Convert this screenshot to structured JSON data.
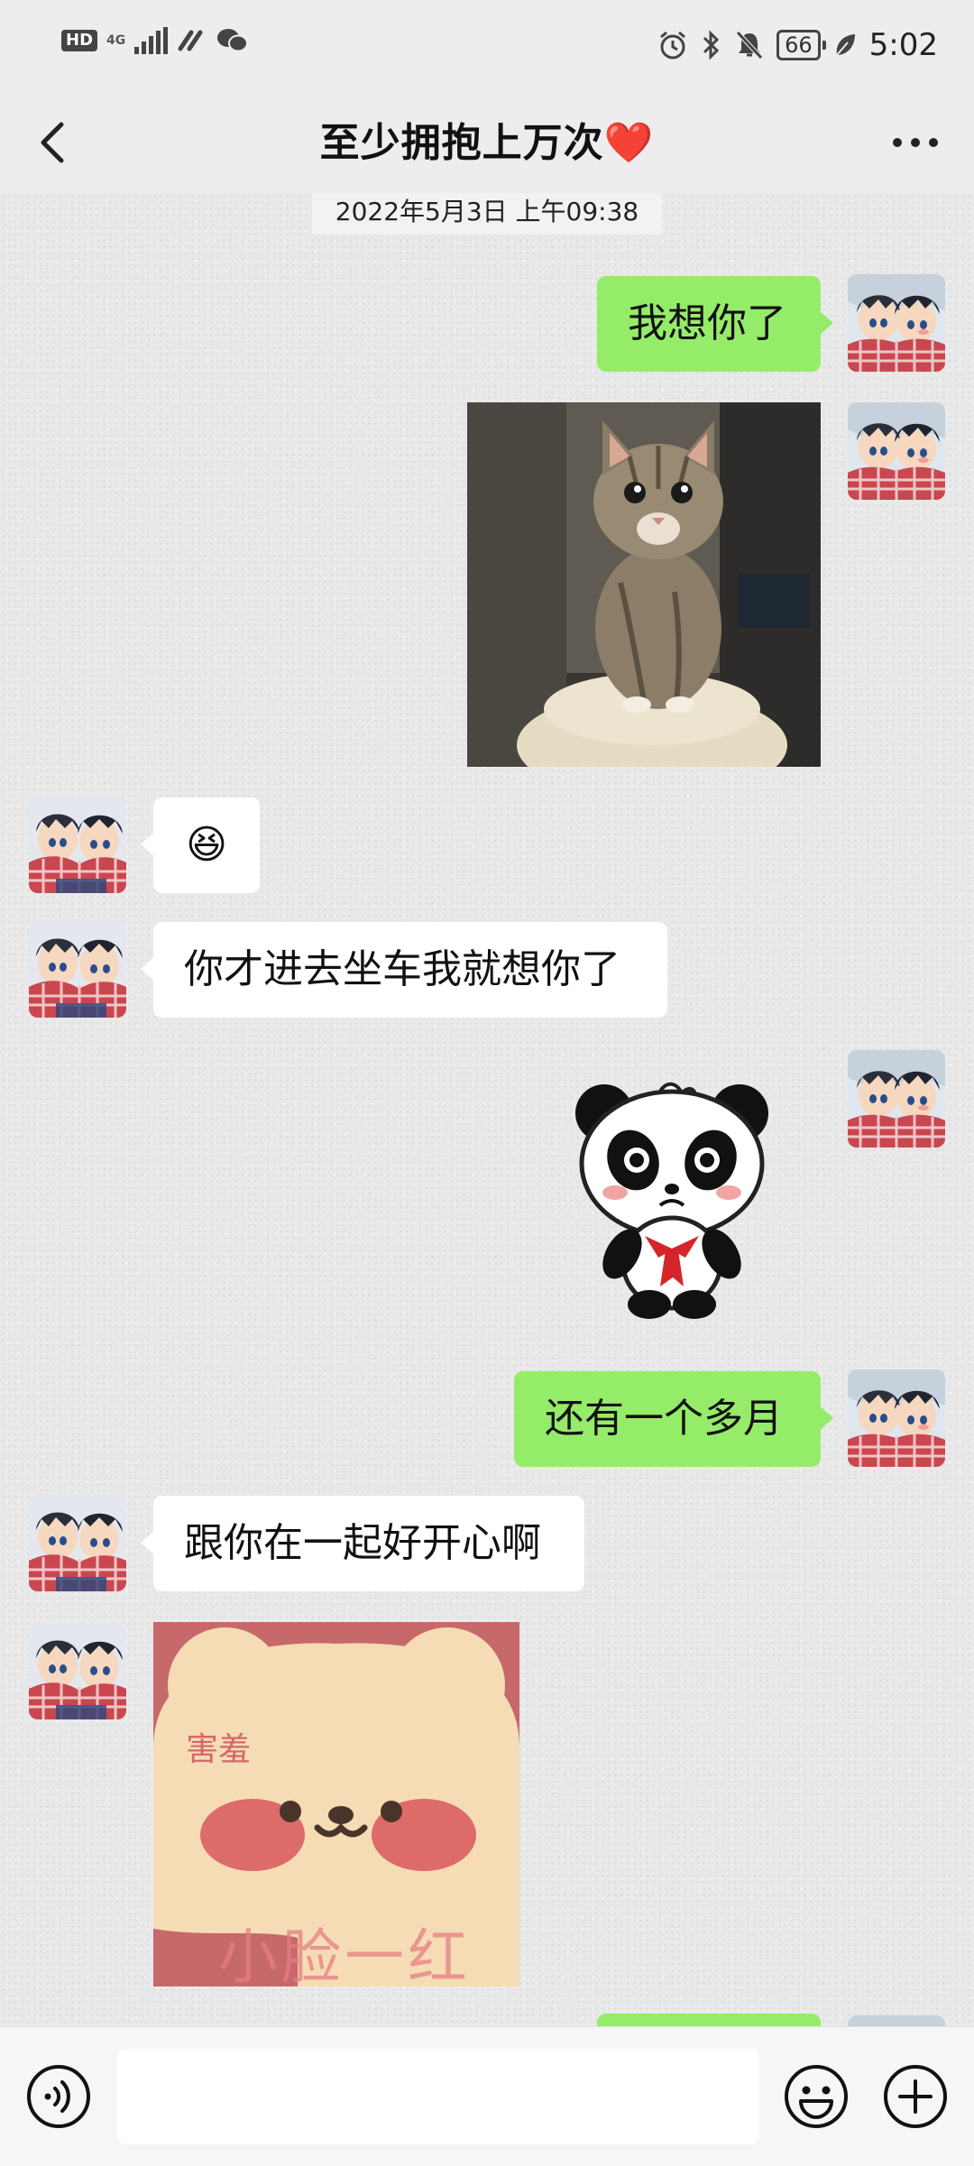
{
  "status_bar": {
    "network": "4G",
    "hd": "HD",
    "battery": "66",
    "time": "5:02"
  },
  "header": {
    "title": "至少拥抱上万次",
    "title_emoji": "❤️",
    "back_icon": "chevron-left-icon",
    "more_icon": "more-dots-icon"
  },
  "chat": {
    "timestamp": "2022年5月3日 上午09:38",
    "messages": [
      {
        "from": "me",
        "type": "text",
        "text": "我想你了"
      },
      {
        "from": "me",
        "type": "image",
        "image": "cat-photo"
      },
      {
        "from": "them",
        "type": "emoji",
        "text": "😆"
      },
      {
        "from": "them",
        "type": "text",
        "text": "你才进去坐车我就想你了"
      },
      {
        "from": "me",
        "type": "sticker",
        "image": "panda-sticker"
      },
      {
        "from": "me",
        "type": "text",
        "text": "还有一个多月"
      },
      {
        "from": "them",
        "type": "text",
        "text": "跟你在一起好开心啊"
      },
      {
        "from": "them",
        "type": "sticker",
        "image": "bear-sticker",
        "caption_small": "害羞",
        "caption_big": "小脸一红"
      }
    ]
  },
  "input_bar": {
    "voice_icon": "voice-icon",
    "emoji_icon": "emoji-icon",
    "plus_icon": "plus-icon",
    "placeholder": ""
  },
  "colors": {
    "my_bubble": "#95ec69",
    "their_bubble": "#ffffff",
    "background": "#ededed"
  }
}
